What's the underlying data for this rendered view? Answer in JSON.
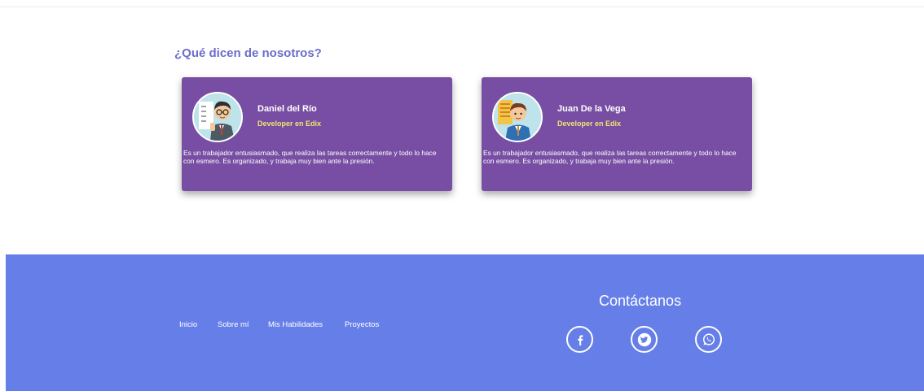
{
  "section": {
    "title": "¿Qué dicen de nosotros?"
  },
  "testimonials": [
    {
      "name": "Daniel del Río",
      "role": "Developer en Edix",
      "text": "Es un trabajador entusiasmado, que realiza las tareas correctamente y todo lo hace con esmero. Es organizado, y trabaja muy bien ante la presión."
    },
    {
      "name": "Juan De la Vega",
      "role": "Developer en Edix",
      "text": "Es un trabajador entusiasmado, que realiza las tareas correctamente y todo lo hace con esmero. Es organizado, y trabaja muy bien ante la presión."
    }
  ],
  "footer": {
    "nav": [
      "Inicio",
      "Sobre mí",
      "Mis Habilidades",
      "Proyectos"
    ],
    "contact_title": "Contáctanos",
    "social": [
      "facebook-icon",
      "twitter-icon",
      "whatsapp-icon"
    ]
  },
  "colors": {
    "card_bg": "#774ea3",
    "footer_bg": "#667fe8",
    "title": "#6a6ec9",
    "role": "#f3e56d"
  }
}
